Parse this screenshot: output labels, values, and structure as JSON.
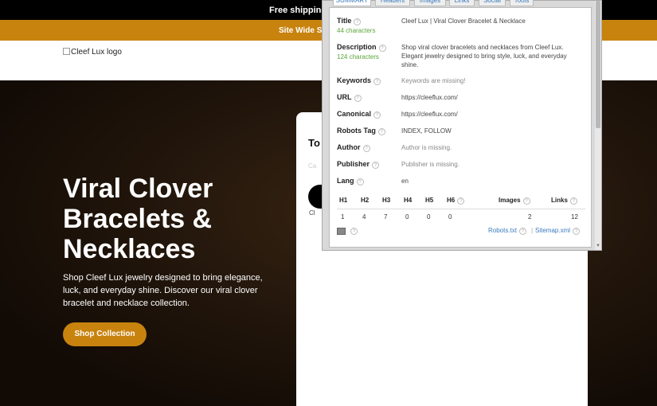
{
  "site": {
    "top_banner": "Free shipping o",
    "sale_banner": "Site Wide Sal",
    "logo_alt": "Cleef Lux logo",
    "hero_title": "Viral Clover Bracelets & Necklaces",
    "hero_desc": "Shop Cleef Lux jewelry designed to bring elegance, luck, and everyday shine. Discover our viral clover bracelet and necklace collection.",
    "shop_button": "Shop Collection",
    "card_title": "To",
    "card_faint": "Ca",
    "card_img_alt": "Cl"
  },
  "panel": {
    "tabs": [
      "SUMMARY",
      "Headers",
      "Images",
      "Links",
      "Social",
      "Tools"
    ],
    "rows": {
      "title_label": "Title",
      "title_value": "Cleef Lux | Viral Clover Bracelet & Necklace",
      "title_count": "44 characters",
      "desc_label": "Description",
      "desc_value": "Shop viral clover bracelets and necklaces from Cleef Lux. Elegant jewelry designed to bring style, luck, and everyday shine.",
      "desc_count": "124 characters",
      "keywords_label": "Keywords",
      "keywords_value": "Keywords are missing!",
      "url_label": "URL",
      "url_value": "https://cleeflux.com/",
      "canonical_label": "Canonical",
      "canonical_value": "https://cleeflux.com/",
      "robots_label": "Robots Tag",
      "robots_value": "INDEX, FOLLOW",
      "author_label": "Author",
      "author_value": "Author is missing.",
      "publisher_label": "Publisher",
      "publisher_value": "Publisher is missing.",
      "lang_label": "Lang",
      "lang_value": "en"
    },
    "headings": {
      "labels": [
        "H1",
        "H2",
        "H3",
        "H4",
        "H5",
        "H6"
      ],
      "values": [
        "1",
        "4",
        "7",
        "0",
        "0",
        "0"
      ],
      "images_label": "Images",
      "images_value": "2",
      "links_label": "Links",
      "links_value": "12"
    },
    "footer": {
      "robots_link": "Robots.txt",
      "separator": "|",
      "sitemap_link": "Sitemap.xml"
    },
    "help_glyph": "?"
  },
  "colors": {
    "accent_gold": "#c8830f",
    "link_blue": "#3b7bbf",
    "count_green": "#5aa53a"
  }
}
